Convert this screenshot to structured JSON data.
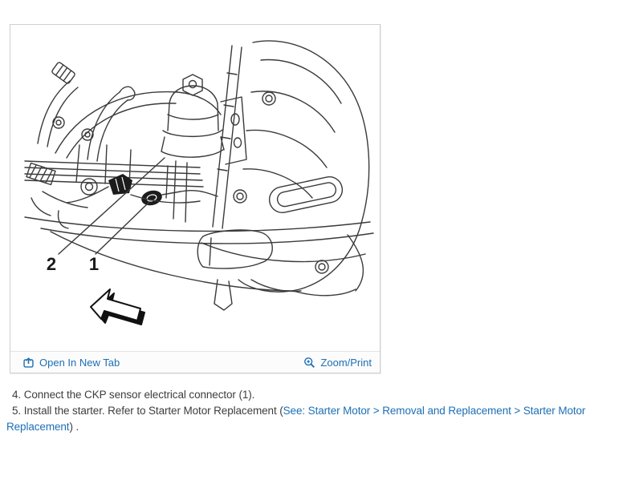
{
  "figure": {
    "labels": {
      "item2": "2",
      "item1": "1"
    },
    "footer": {
      "open_in_new_tab": "Open In New Tab",
      "zoom_print": "Zoom/Print"
    }
  },
  "instructions": {
    "step4": "4. Connect the CKP sensor electrical connector (1).",
    "step5_before_link": "5. Install the starter. Refer to Starter Motor Replacement (",
    "step5_link": "See: Starter Motor > Removal and Replacement > Starter Motor Replacement",
    "step5_after_link": ") ."
  },
  "colors": {
    "link_blue": "#1d6fb5",
    "body_text": "#3d3d3d",
    "line_art": "#3a3a3a",
    "connector_fill": "#1c1c1c",
    "card_border": "#cfcfcf",
    "footer_bg": "#fcfcfc"
  }
}
